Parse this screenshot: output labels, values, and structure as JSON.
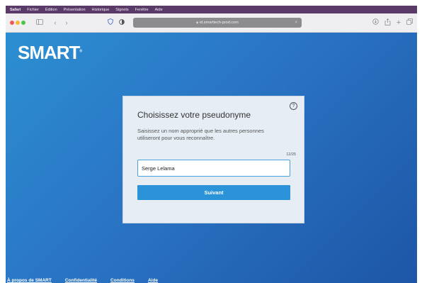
{
  "menubar": {
    "app": "Safari",
    "items": [
      "Fichier",
      "Édition",
      "Présentation",
      "Historique",
      "Signets",
      "Fenêtre",
      "Aide"
    ]
  },
  "browser": {
    "url": "id.smarttech-prod.com"
  },
  "logo": {
    "text": "SMART",
    "mark": "®"
  },
  "card": {
    "title": "Choisissez votre pseudonyme",
    "description": "Saisissez un nom approprié que les autres personnes utiliseront pour vous reconnaître.",
    "counter": "12/25",
    "input_value": "Serge Lelama",
    "next_label": "Suivant"
  },
  "footer": {
    "links": [
      "À propos de SMART",
      "Confidentialité",
      "Conditions",
      "Aide"
    ]
  },
  "colors": {
    "accent": "#2b93d8",
    "page_gradient_start": "#2c8fd2",
    "page_gradient_end": "#1d56a6",
    "menubar": "#5a3a66"
  }
}
